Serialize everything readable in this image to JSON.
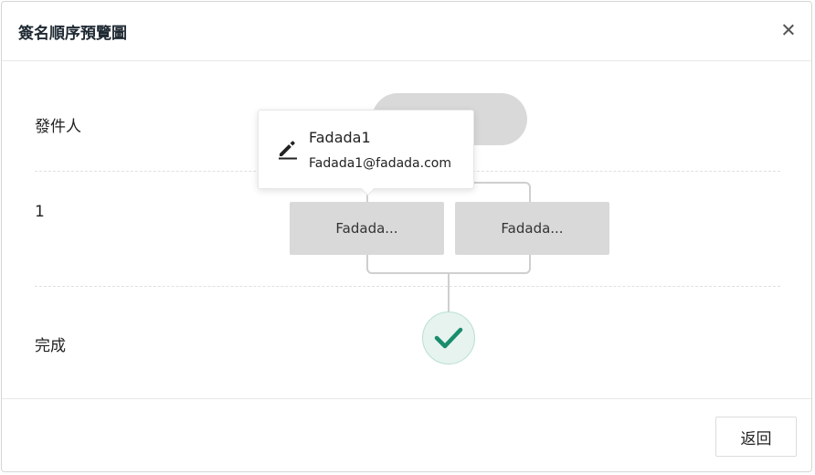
{
  "dialog": {
    "title": "簽名順序預覽圖",
    "close_icon": "close-icon"
  },
  "rows": {
    "sender_label": "發件人",
    "step1_label": "1",
    "complete_label": "完成"
  },
  "signers": [
    {
      "label": "Fadada..."
    },
    {
      "label": "Fadada..."
    }
  ],
  "tooltip": {
    "icon": "pen-icon",
    "name": "Fadada1",
    "email": "Fadada1@fadada.com"
  },
  "complete": {
    "icon": "check-icon",
    "color": "#1a8c6c"
  },
  "footer": {
    "back_label": "返回"
  }
}
